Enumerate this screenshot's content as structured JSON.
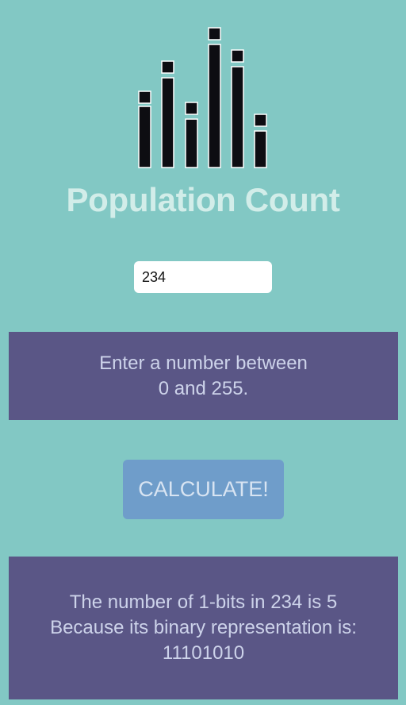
{
  "app": {
    "title": "Population Count"
  },
  "logo": {
    "icon": "bar-chart-icon",
    "color": "#0d0d12"
  },
  "input": {
    "value": "234"
  },
  "instruction": {
    "line1": "Enter a number between",
    "line2": "0 and 255."
  },
  "button": {
    "label": "CALCULATE!"
  },
  "result": {
    "line1": "The number of 1-bits in 234 is 5",
    "line2": "Because its binary representation is:",
    "line3": "11101010"
  },
  "colors": {
    "background": "#82c8c4",
    "panel": "#5a5686",
    "panel_text": "#cdd3ea",
    "title": "#d2ede9",
    "button": "#6f9dca",
    "button_text": "#d8e4f2"
  }
}
